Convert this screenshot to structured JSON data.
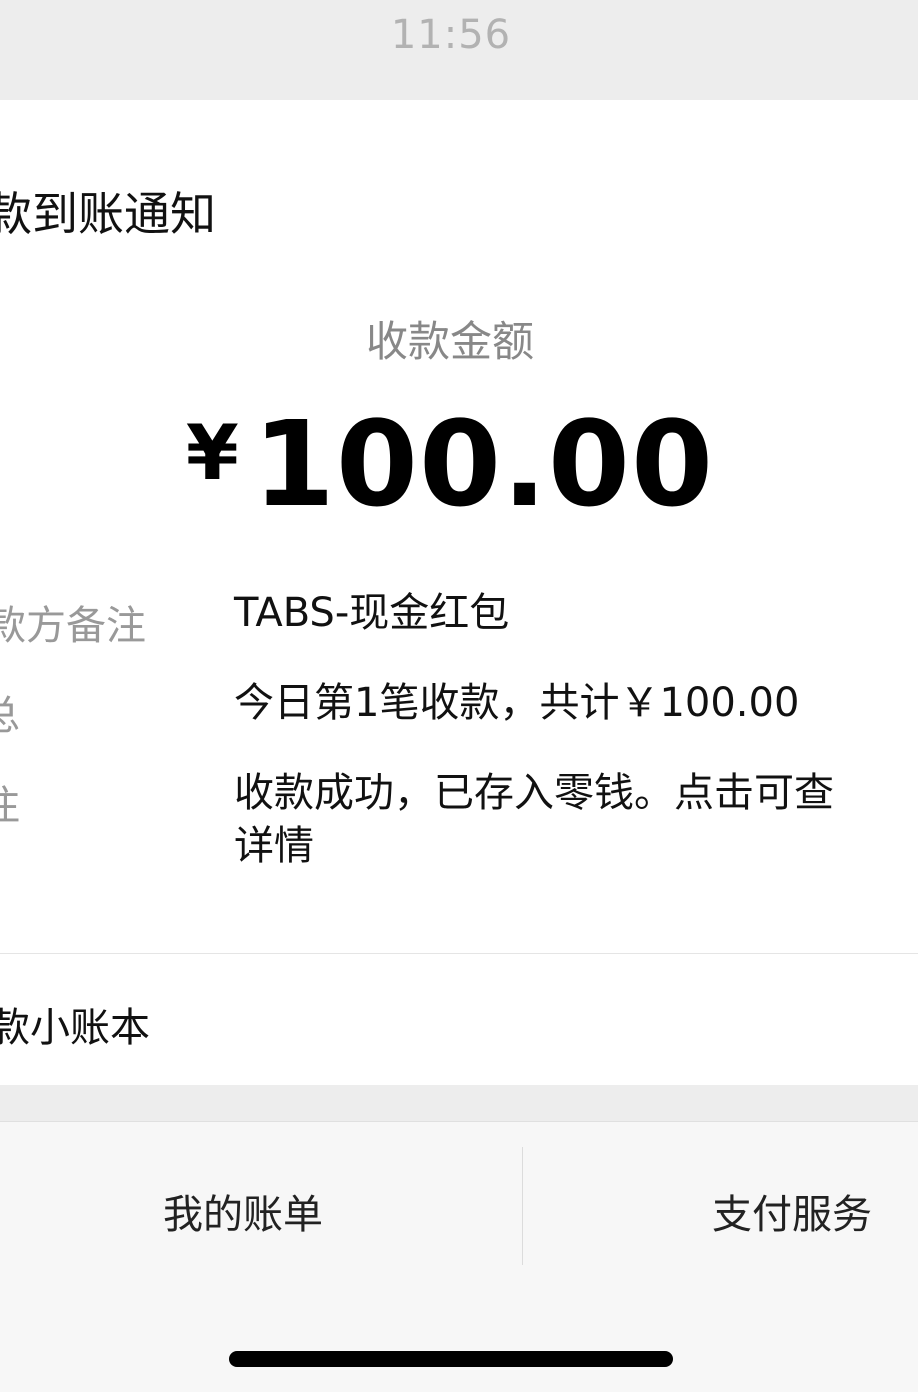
{
  "status_bar": {
    "time": "11:56"
  },
  "notification": {
    "title": "款到账通知",
    "amount_label": "收款金额",
    "currency_symbol": "¥",
    "amount": "100.00",
    "rows": [
      {
        "label": "款方备注",
        "value": "TABS-现金红包"
      },
      {
        "label": "总",
        "value": "今日第1笔收款，共计￥100.00"
      },
      {
        "label": "注",
        "value_line1": "收款成功，已存入零钱。点击可查",
        "value_line2": "详情"
      }
    ],
    "ledger_link": "款小账本"
  },
  "footer": {
    "left_button": "我的账单",
    "right_button": "支付服务"
  },
  "colors": {
    "background": "#ededed",
    "card": "#ffffff",
    "muted_text": "#999999",
    "primary_text": "#111111"
  }
}
